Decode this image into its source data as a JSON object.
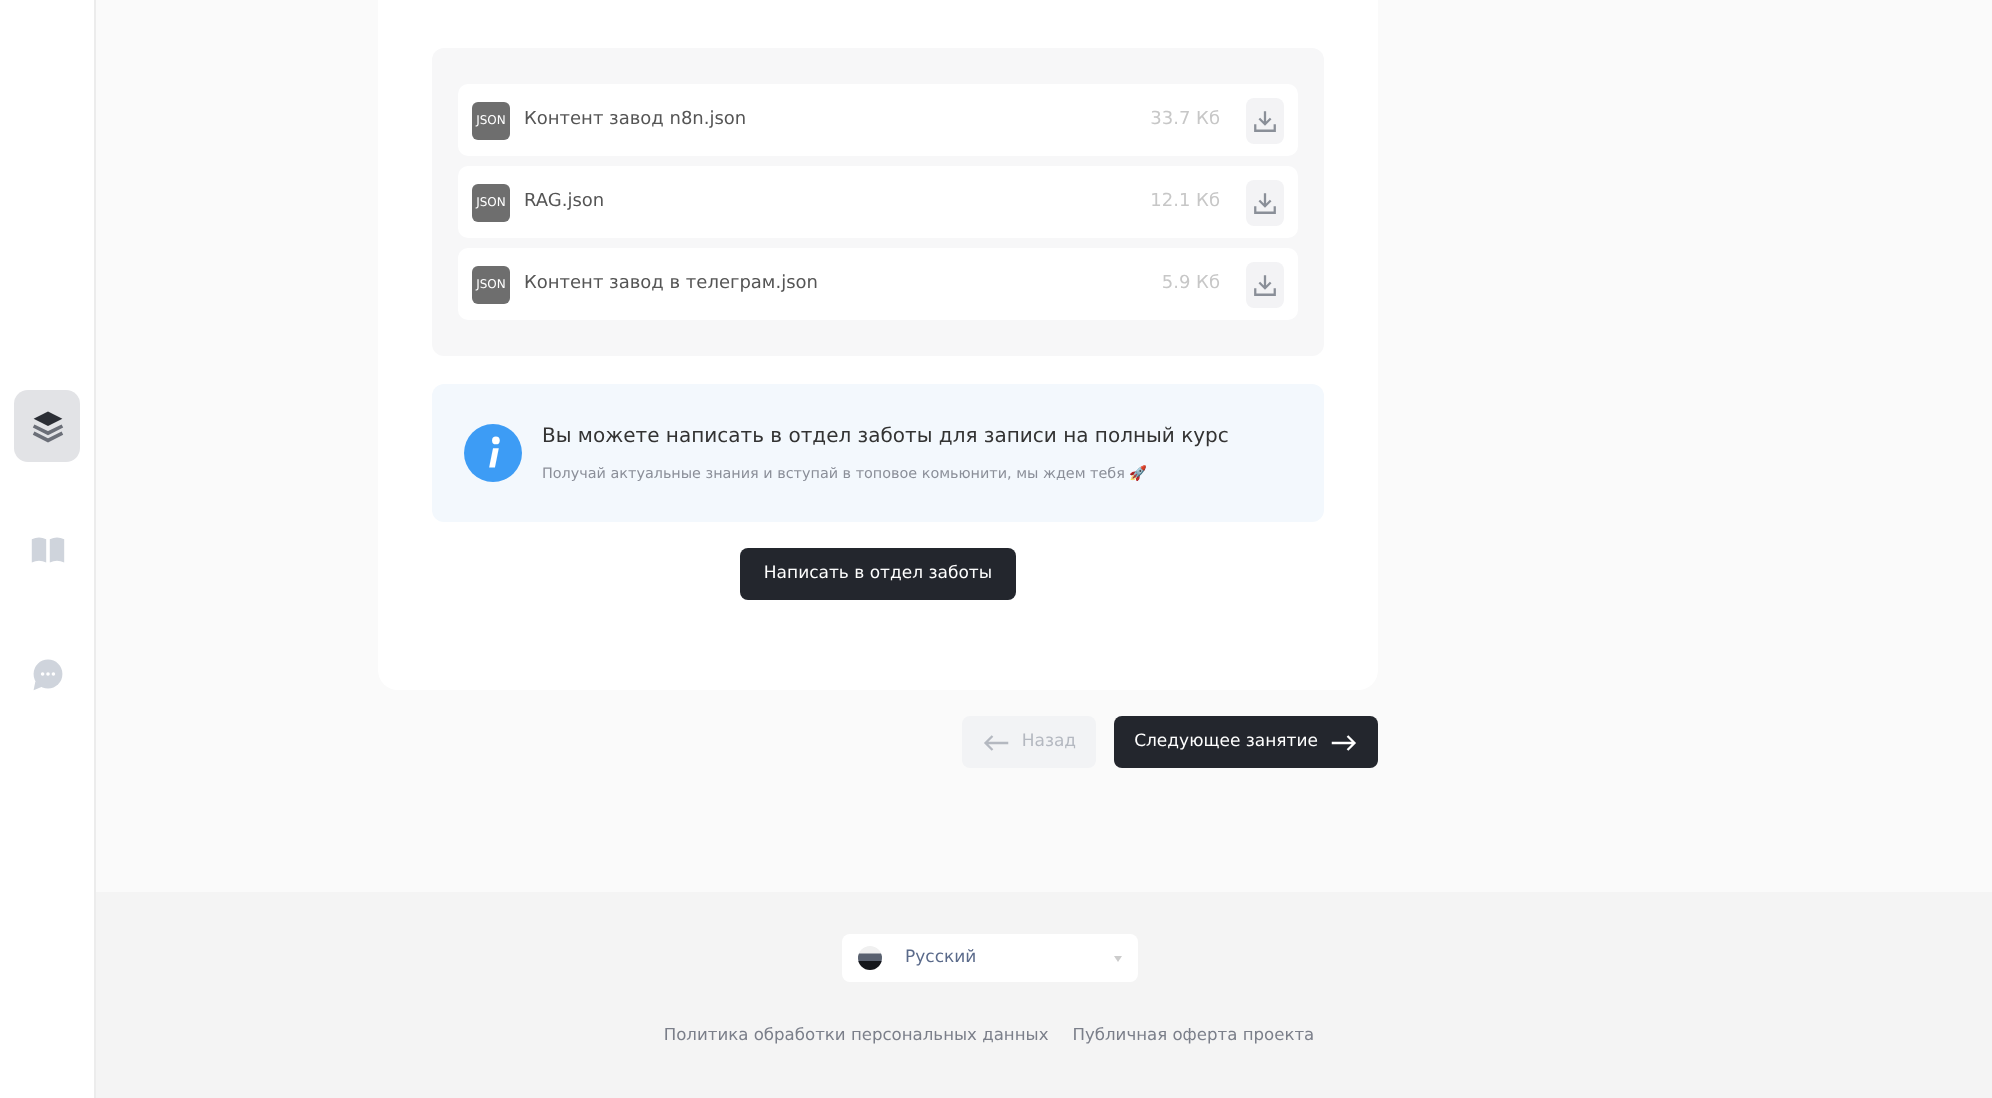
{
  "sidebar": {
    "items": [
      {
        "kind": "layers",
        "selected": true
      },
      {
        "kind": "book",
        "selected": false
      },
      {
        "kind": "chat",
        "selected": false
      }
    ]
  },
  "files": [
    {
      "badge": "JSON",
      "name": "Контент завод n8n.json",
      "size": "33.7 Кб"
    },
    {
      "badge": "JSON",
      "name": "RAG.json",
      "size": "12.1 Кб"
    },
    {
      "badge": "JSON",
      "name": "Контент завод в телеграм.json",
      "size": "5.9 Кб"
    }
  ],
  "notice": {
    "title": "Вы можете написать в отдел заботы для записи на полный курс",
    "text": "Получай актуальные знания и вступай в топовое комьюнити, мы ждем тебя 🚀"
  },
  "contact_button": "Написать в отдел заботы",
  "nav": {
    "back": {
      "label": "Назад",
      "disabled": true
    },
    "next": {
      "label": "Следующее занятие",
      "disabled": false
    }
  },
  "footer": {
    "language": "Русский",
    "links": [
      "Политика обработки персональных данных",
      "Публичная оферта проекта"
    ]
  }
}
